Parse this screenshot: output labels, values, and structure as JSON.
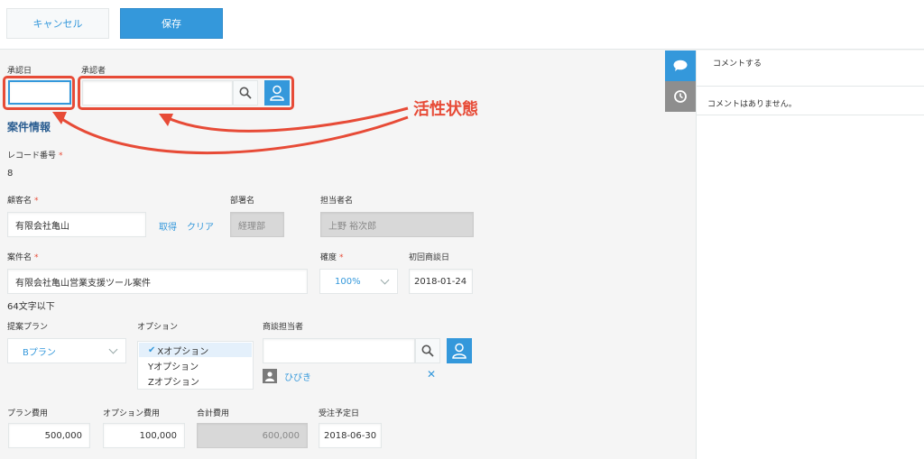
{
  "toolbar": {
    "cancel_label": "キャンセル",
    "save_label": "保存"
  },
  "approval": {
    "date_label": "承認日",
    "approver_label": "承認者",
    "date_value": "",
    "approver_value": ""
  },
  "section_title": "案件情報",
  "record": {
    "label": "レコード番号",
    "value": "8"
  },
  "customer": {
    "label": "顧客名",
    "value": "有限会社亀山",
    "fetch_label": "取得",
    "clear_label": "クリア"
  },
  "department": {
    "label": "部署名",
    "value": "経理部"
  },
  "contact": {
    "label": "担当者名",
    "value": "上野 裕次郎"
  },
  "deal": {
    "label": "案件名",
    "value": "有限会社亀山営業支援ツール案件",
    "hint": "64文字以下"
  },
  "probability": {
    "label": "確度",
    "value": "100%"
  },
  "first_meeting": {
    "label": "初回商談日",
    "value": "2018-01-24"
  },
  "plan": {
    "label": "提案プラン",
    "value": "Bプラン"
  },
  "options": {
    "label": "オプション",
    "items": [
      {
        "label": "Xオプション",
        "selected": true
      },
      {
        "label": "Yオプション",
        "selected": false
      },
      {
        "label": "Zオプション",
        "selected": false
      }
    ],
    "check": "✔"
  },
  "sales_rep": {
    "label": "商談担当者",
    "input_value": "",
    "chip_name": "ひびき",
    "remove_label": "✕"
  },
  "costs": {
    "plan_cost": {
      "label": "プラン費用",
      "value": "500,000"
    },
    "option_cost": {
      "label": "オプション費用",
      "value": "100,000"
    },
    "total_cost": {
      "label": "合計費用",
      "value": "600,000"
    }
  },
  "order_date": {
    "label": "受注予定日",
    "value": "2018-06-30"
  },
  "required_mark": "*",
  "annotation": {
    "text": "活性状態",
    "color": "#e74b37"
  },
  "comments": {
    "prompt": "コメントする",
    "empty_text": "コメントはありません。"
  },
  "icons": {
    "search": "search-icon",
    "user": "user-icon",
    "comment": "speech-bubble-icon",
    "history": "clock-history-icon"
  },
  "colors": {
    "accent": "#3498db",
    "required": "#e74b37",
    "section_title": "#2a5d91"
  }
}
